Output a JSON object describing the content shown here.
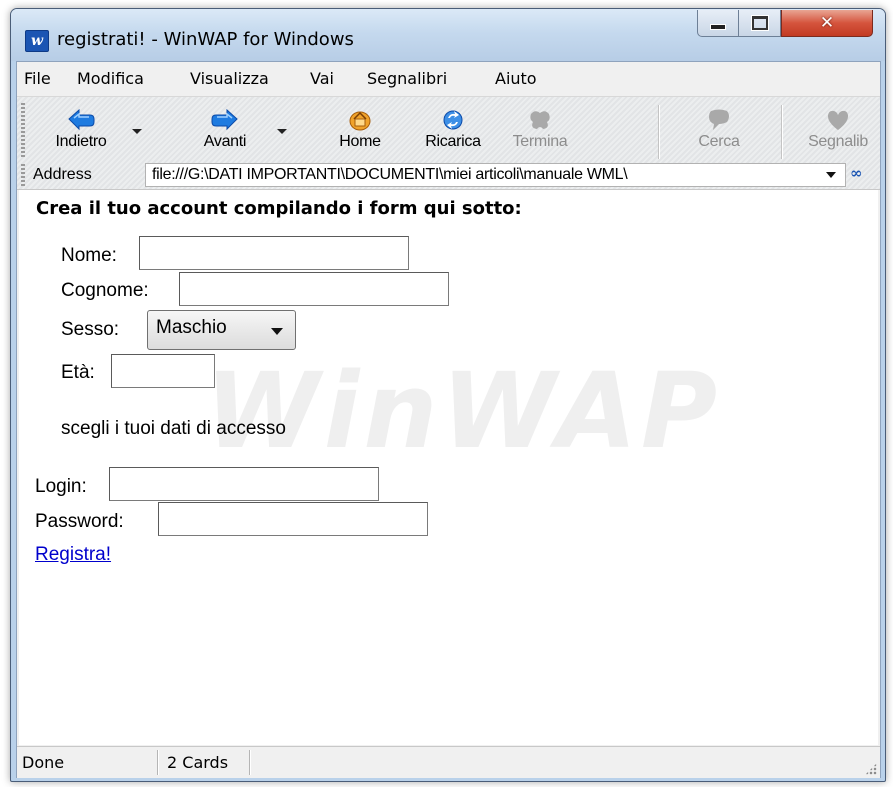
{
  "window": {
    "title": "registrati! - WinWAP for Windows",
    "app_icon": "w",
    "controls": [
      "minimize-icon",
      "maximize-icon",
      "close-icon"
    ]
  },
  "menubar": {
    "items": [
      "File",
      "Modifica",
      "Visualizza",
      "Vai",
      "Segnalibri",
      "Aiuto"
    ]
  },
  "toolbar": {
    "buttons": [
      {
        "label": "Indietro",
        "icon": "back-arrow-icon",
        "enabled": true
      },
      {
        "label": "Avanti",
        "icon": "forward-arrow-icon",
        "enabled": true
      },
      {
        "label": "Home",
        "icon": "home-icon",
        "enabled": true
      },
      {
        "label": "Ricarica",
        "icon": "reload-icon",
        "enabled": true
      },
      {
        "label": "Termina",
        "icon": "stop-icon",
        "enabled": false
      },
      {
        "label": "Cerca",
        "icon": "search-icon",
        "enabled": false
      },
      {
        "label": "Segnalib",
        "icon": "bookmarks-icon",
        "enabled": false
      }
    ]
  },
  "address": {
    "label": "Address",
    "value": "file:///G:\\DATI IMPORTANTI\\DOCUMENTI\\miei articoli\\manuale WML\\",
    "logo": "∞"
  },
  "page": {
    "heading": "Crea il tuo account compilando i form qui sotto:",
    "watermark": "winwap",
    "fields": {
      "nome_label": "Nome:",
      "cognome_label": "Cognome:",
      "sesso_label": "Sesso:",
      "sesso_value": "Maschio",
      "eta_label": "Età:",
      "access_text": "scegli i tuoi dati di accesso",
      "login_label": "Login:",
      "password_label": "Password:"
    },
    "link": "Registra!"
  },
  "status": {
    "text": "Done",
    "cards": "2 Cards"
  },
  "colors": {
    "link": "#0000cc",
    "titlebar": "#c5d9ee",
    "close_button": "#d5543d"
  }
}
